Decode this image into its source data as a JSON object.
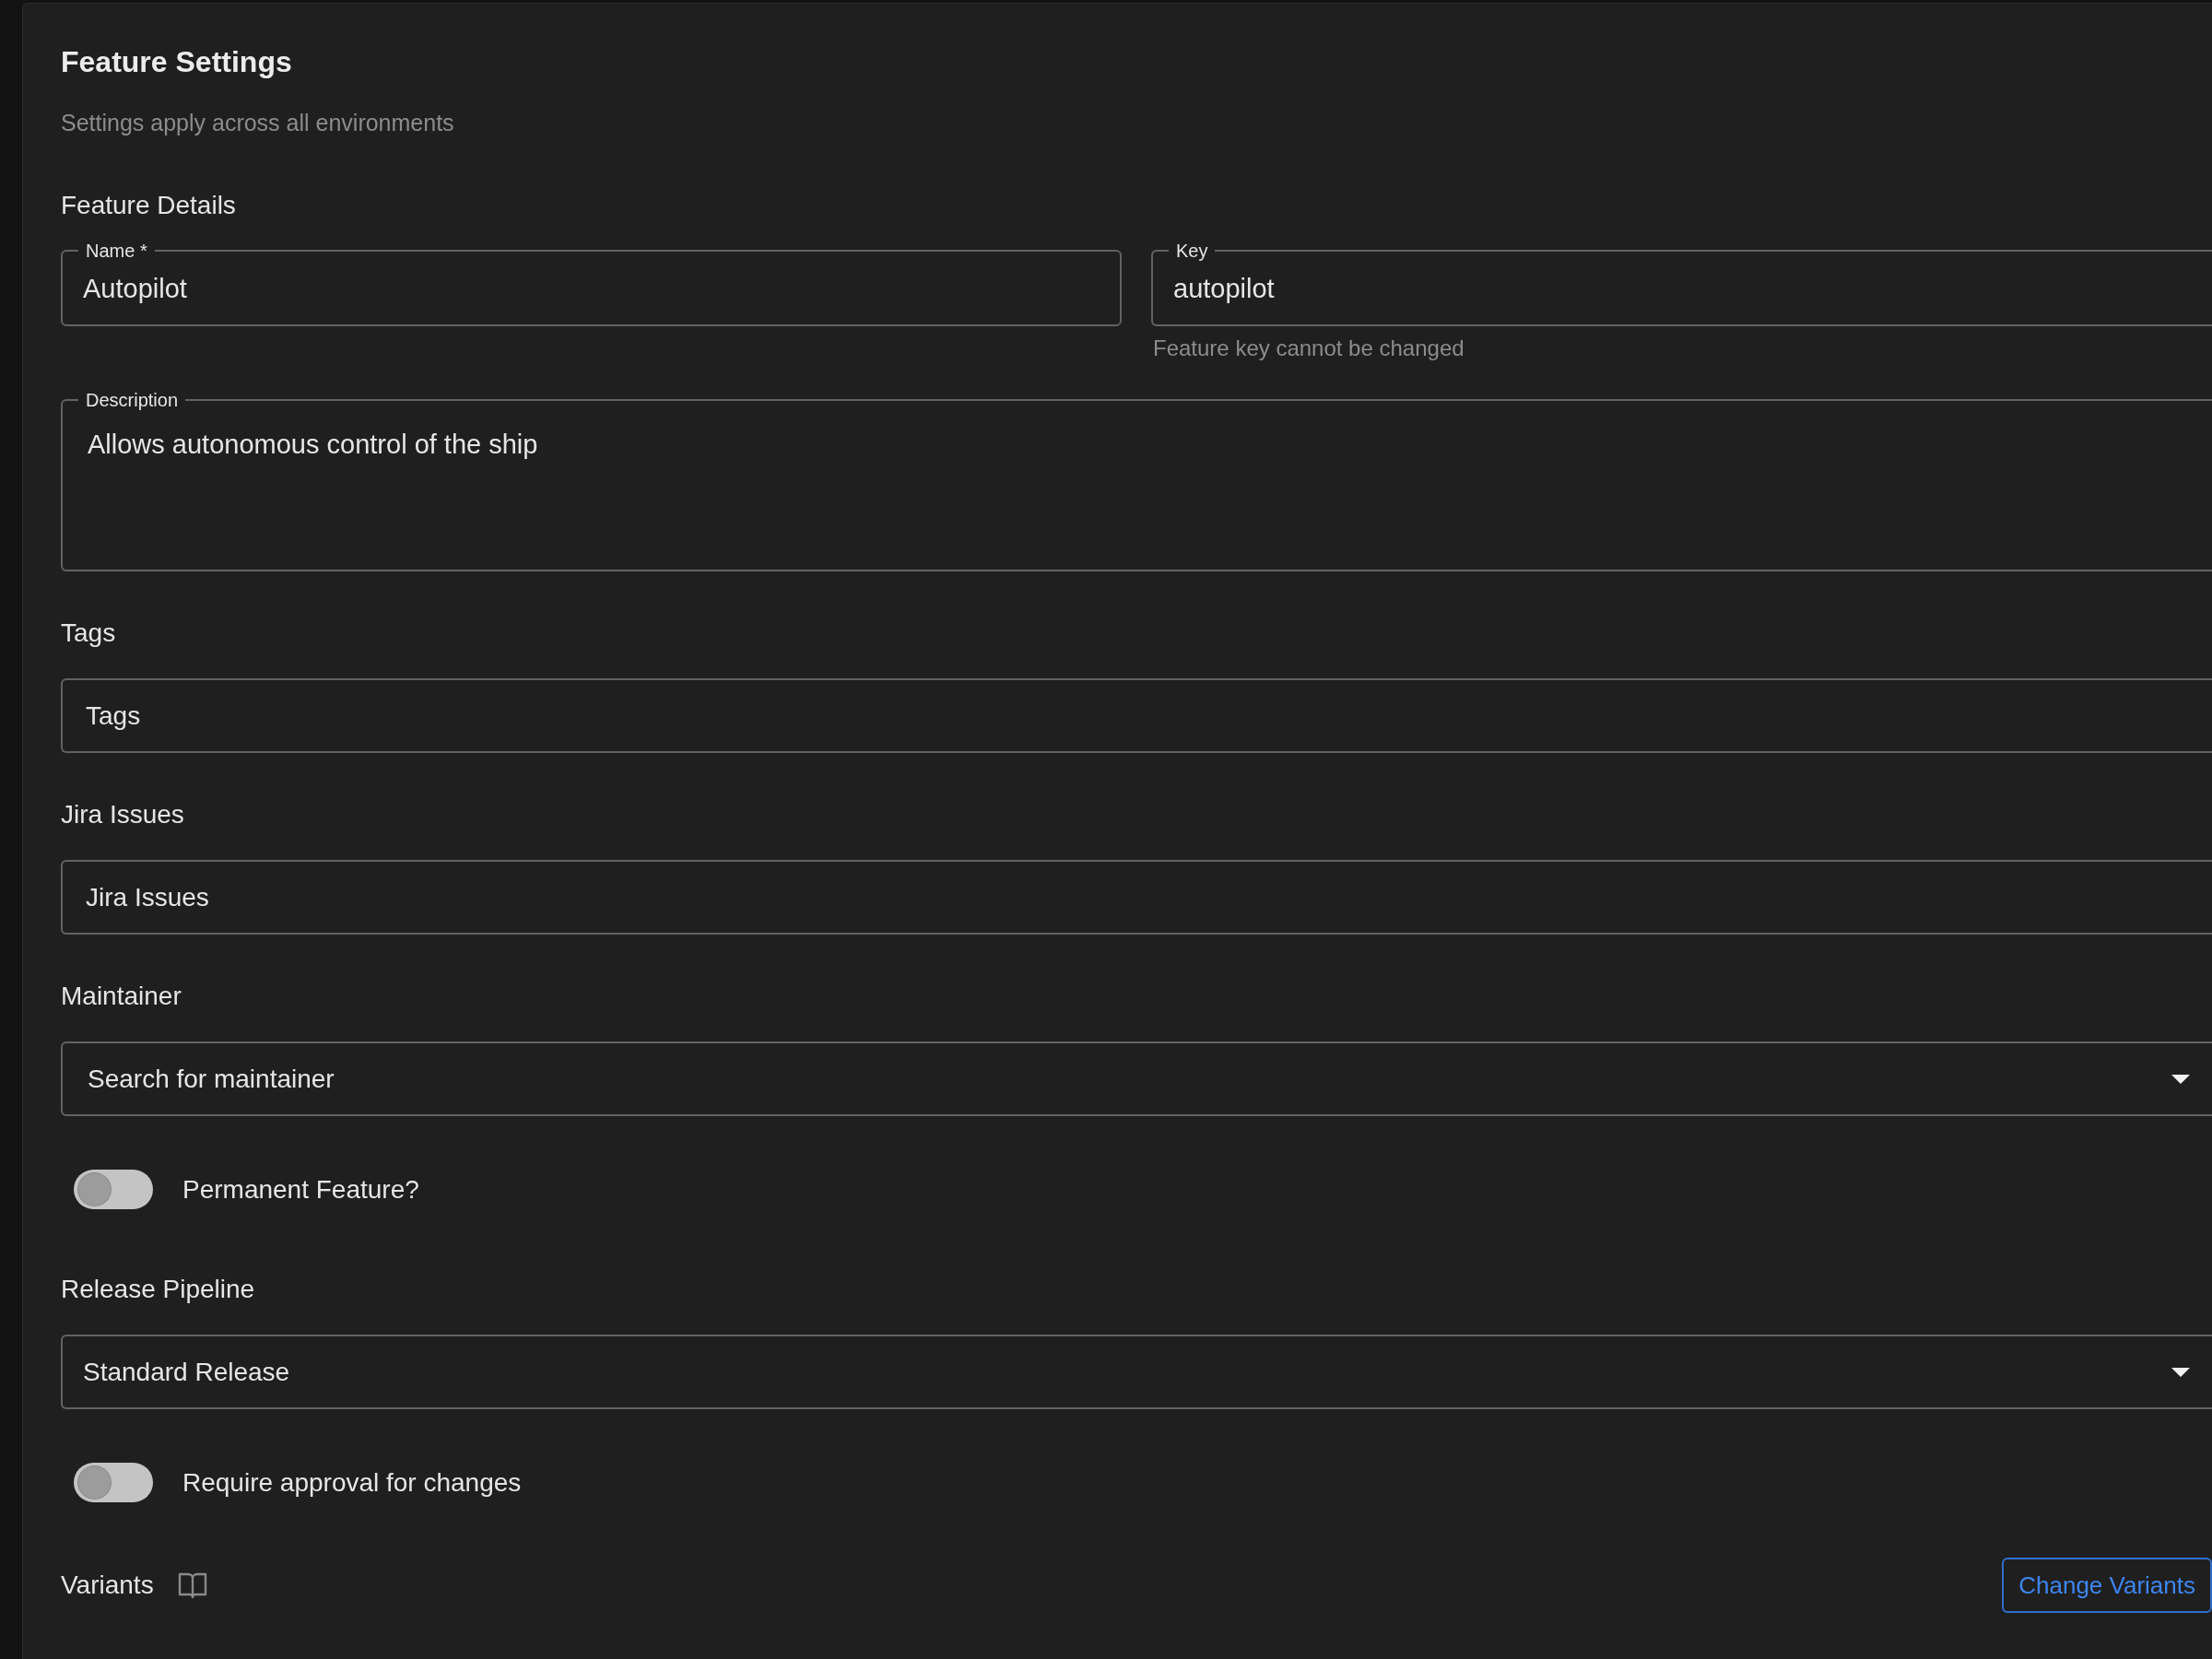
{
  "panel": {
    "title": "Feature Settings",
    "subtitle": "Settings apply across all environments"
  },
  "details": {
    "heading": "Feature Details",
    "name_field": {
      "label": "Name *",
      "value": "Autopilot"
    },
    "key_field": {
      "label": "Key",
      "value": "autopilot",
      "helper": "Feature key cannot be changed"
    },
    "description_field": {
      "label": "Description",
      "value": "Allows autonomous control of the ship"
    }
  },
  "sections": [
    {
      "kind": "input",
      "label": "Tags",
      "placeholder": "Tags"
    },
    {
      "kind": "input",
      "label": "Jira Issues",
      "placeholder": "Jira Issues"
    },
    {
      "kind": "select",
      "label": "Maintainer",
      "placeholder": "Search for maintainer"
    },
    {
      "kind": "toggle",
      "label": "Permanent Feature?",
      "on": false
    },
    {
      "kind": "select",
      "label": "Release Pipeline",
      "value": "Standard Release"
    },
    {
      "kind": "toggle",
      "label": "Require approval for changes",
      "on": false
    }
  ],
  "variants": {
    "heading": "Variants",
    "button": "Change Variants"
  }
}
